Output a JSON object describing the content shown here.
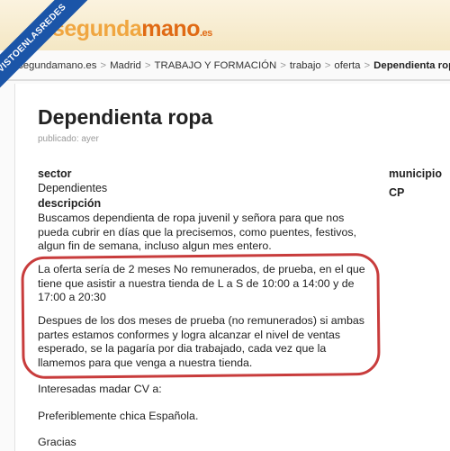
{
  "watermark": "VISTOENLASREDES",
  "logo": {
    "part1": "segunda",
    "part2": "mano",
    "part3": ".es"
  },
  "breadcrumb": {
    "items": [
      "segundamano.es",
      "Madrid",
      "TRABAJO Y FORMACIÓN",
      "trabajo",
      "oferta"
    ],
    "current": "Dependienta ropa",
    "separator": ">"
  },
  "ad": {
    "title": "Dependienta ropa",
    "published": "publicado: ayer",
    "sector_label": "sector",
    "sector_value": "Dependientes",
    "description_label": "descripción",
    "municipio_label": "municipio",
    "cp_label": "CP",
    "paragraphs": [
      "Buscamos dependienta de ropa juvenil y señora para que nos pueda cubrir en días que la precisemos, como puentes, festivos, algun fin de semana, incluso algun mes entero.",
      "La oferta sería de 2 meses No remunerados, de prueba, en el que tiene que asistir a nuestra tienda de L a S de 10:00 a 14:00 y de 17:00 a 20:30",
      "Despues de los dos meses de prueba (no remunerados) si ambas partes estamos conformes y logra alcanzar el nivel de ventas esperado, se la pagaría por dia trabajado, cada vez que la llamemos para que venga a nuestra tienda.",
      "Interesadas madar CV a:",
      "Preferiblemente chica Española.",
      "Gracias"
    ]
  },
  "colors": {
    "highlight_oval": "#c83c3c",
    "watermark_bg": "#1b55a8",
    "logo_orange": "#e06a14"
  }
}
